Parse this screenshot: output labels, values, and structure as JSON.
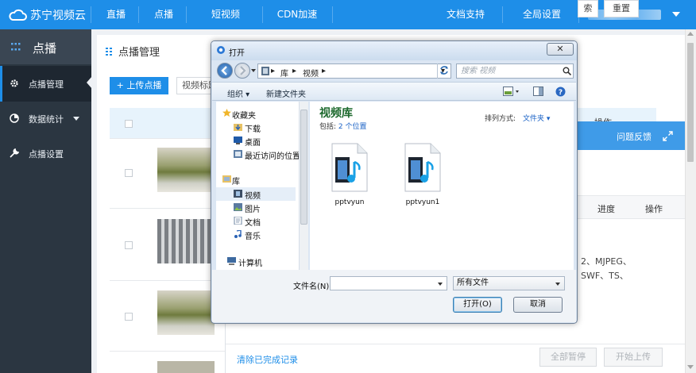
{
  "brand": {
    "name": "苏宁视频云"
  },
  "topnav": {
    "items": [
      "直播",
      "点播",
      "短视频",
      "CDN加速"
    ],
    "right_items": [
      "文档支持",
      "全局设置"
    ]
  },
  "sidebar": {
    "header": "点播",
    "items": [
      {
        "label": "点播管理",
        "icon": "gear-icon"
      },
      {
        "label": "数据统计",
        "icon": "pie-chart-icon"
      },
      {
        "label": "点播设置",
        "icon": "wrench-icon"
      }
    ]
  },
  "main": {
    "title": "点播管理",
    "upload_button": "+ 上传点播",
    "filter_label": "视频标题",
    "search_button": "索",
    "reset_button": "重置",
    "table_header_partial": "操作"
  },
  "upload_panel": {
    "feedback": "问题反馈",
    "columns": {
      "progress": "进度",
      "action": "操作"
    },
    "format_note_line1": "2、MJPEG、",
    "format_note_line2": "SWF、TS、",
    "clear_link": "清除已完成记录",
    "pause_all": "全部暂停",
    "start_upload": "开始上传"
  },
  "dialog": {
    "title": "打开",
    "close": "✕",
    "address": {
      "seg1": "库",
      "seg2": "视频"
    },
    "search_placeholder": "搜索 视频",
    "toolbar": {
      "organize": "组织 ▾",
      "new_folder": "新建文件夹"
    },
    "nav_pane": {
      "favorites": "收藏夹",
      "downloads": "下载",
      "desktop": "桌面",
      "recent": "最近访问的位置",
      "libraries": "库",
      "videos": "视频",
      "pictures": "图片",
      "documents": "文档",
      "music": "音乐",
      "computer": "计算机"
    },
    "library": {
      "title": "视频库",
      "includes_label": "包括:",
      "includes_value": "2 个位置",
      "sort_label": "排列方式:",
      "sort_value": "文件夹 ▾"
    },
    "files": [
      "pptvyun",
      "pptvyun1"
    ],
    "filename_label": "文件名(N):",
    "filename_value": "",
    "filetype_value": "所有文件",
    "open_button": "打开(O)",
    "cancel_button": "取消"
  },
  "colors": {
    "brand_blue": "#1e8ee8",
    "sidebar_dark": "#2b3641",
    "library_green": "#1e6a2e"
  }
}
